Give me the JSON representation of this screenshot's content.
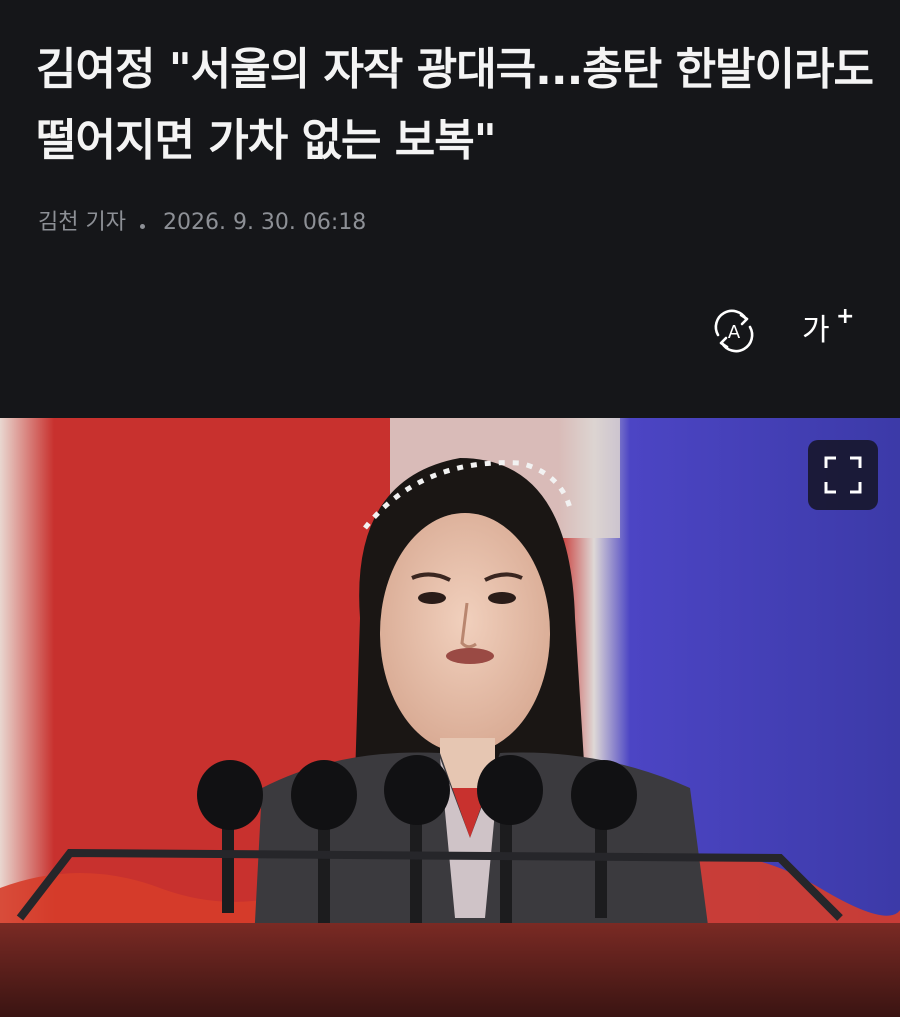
{
  "article": {
    "title": "김여정 \"서울의 자작 광대극...총탄 한발이라도 떨어지면 가차 없는 보복\"",
    "reporter": "김천 기자",
    "datetime": "2026. 9. 30. 06:18"
  },
  "toolbar": {
    "font_size_label": "가",
    "font_size_plus": "+",
    "auto_icon_letter": "A"
  },
  "photo": {
    "expand_icon": "expand-icon"
  },
  "colors": {
    "header_bg": "#151619",
    "title_text": "#f4f4f4",
    "meta_text": "#8d9096",
    "flag_red": "#c8312e",
    "flag_blue": "#4c45c4"
  }
}
